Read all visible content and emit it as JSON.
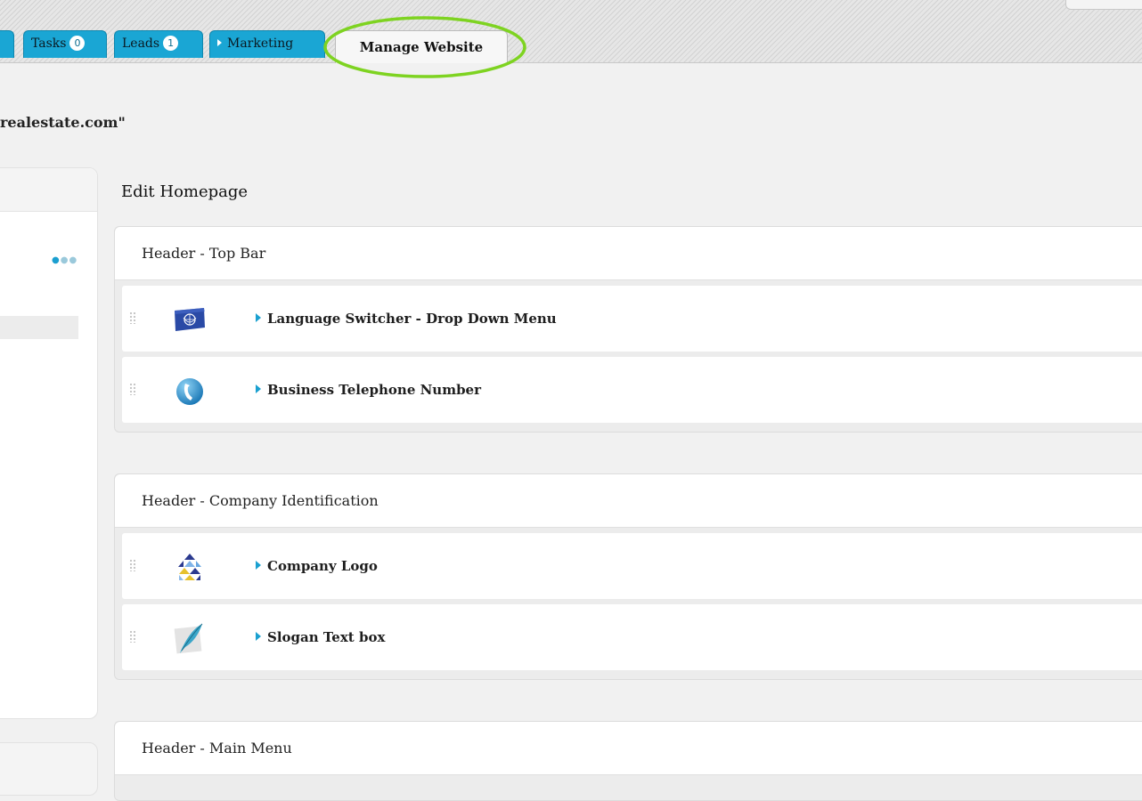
{
  "tabs": {
    "tasks": {
      "label": "Tasks",
      "count": "0"
    },
    "leads": {
      "label": "Leads",
      "count": "1"
    },
    "marketing": {
      "label": "Marketing"
    },
    "manage_website": {
      "label": "Manage Website"
    }
  },
  "site_domain": "realestate.com\"",
  "main": {
    "title": "Edit Homepage",
    "sections": [
      {
        "title": "Header - Top Bar",
        "items": [
          {
            "label": "Language Switcher - Drop Down Menu",
            "icon": "flag-icon"
          },
          {
            "label": "Business Telephone Number",
            "icon": "telephone-icon"
          }
        ]
      },
      {
        "title": "Header - Company Identification",
        "items": [
          {
            "label": "Company Logo",
            "icon": "logo-icon"
          },
          {
            "label": "Slogan Text box",
            "icon": "feather-quill-icon"
          }
        ]
      },
      {
        "title": "Header - Main Menu",
        "items": []
      }
    ]
  },
  "colors": {
    "tab_accent": "#1aa6d4",
    "highlight_ring": "#7ed321",
    "page_background": "#f1f1f1"
  }
}
